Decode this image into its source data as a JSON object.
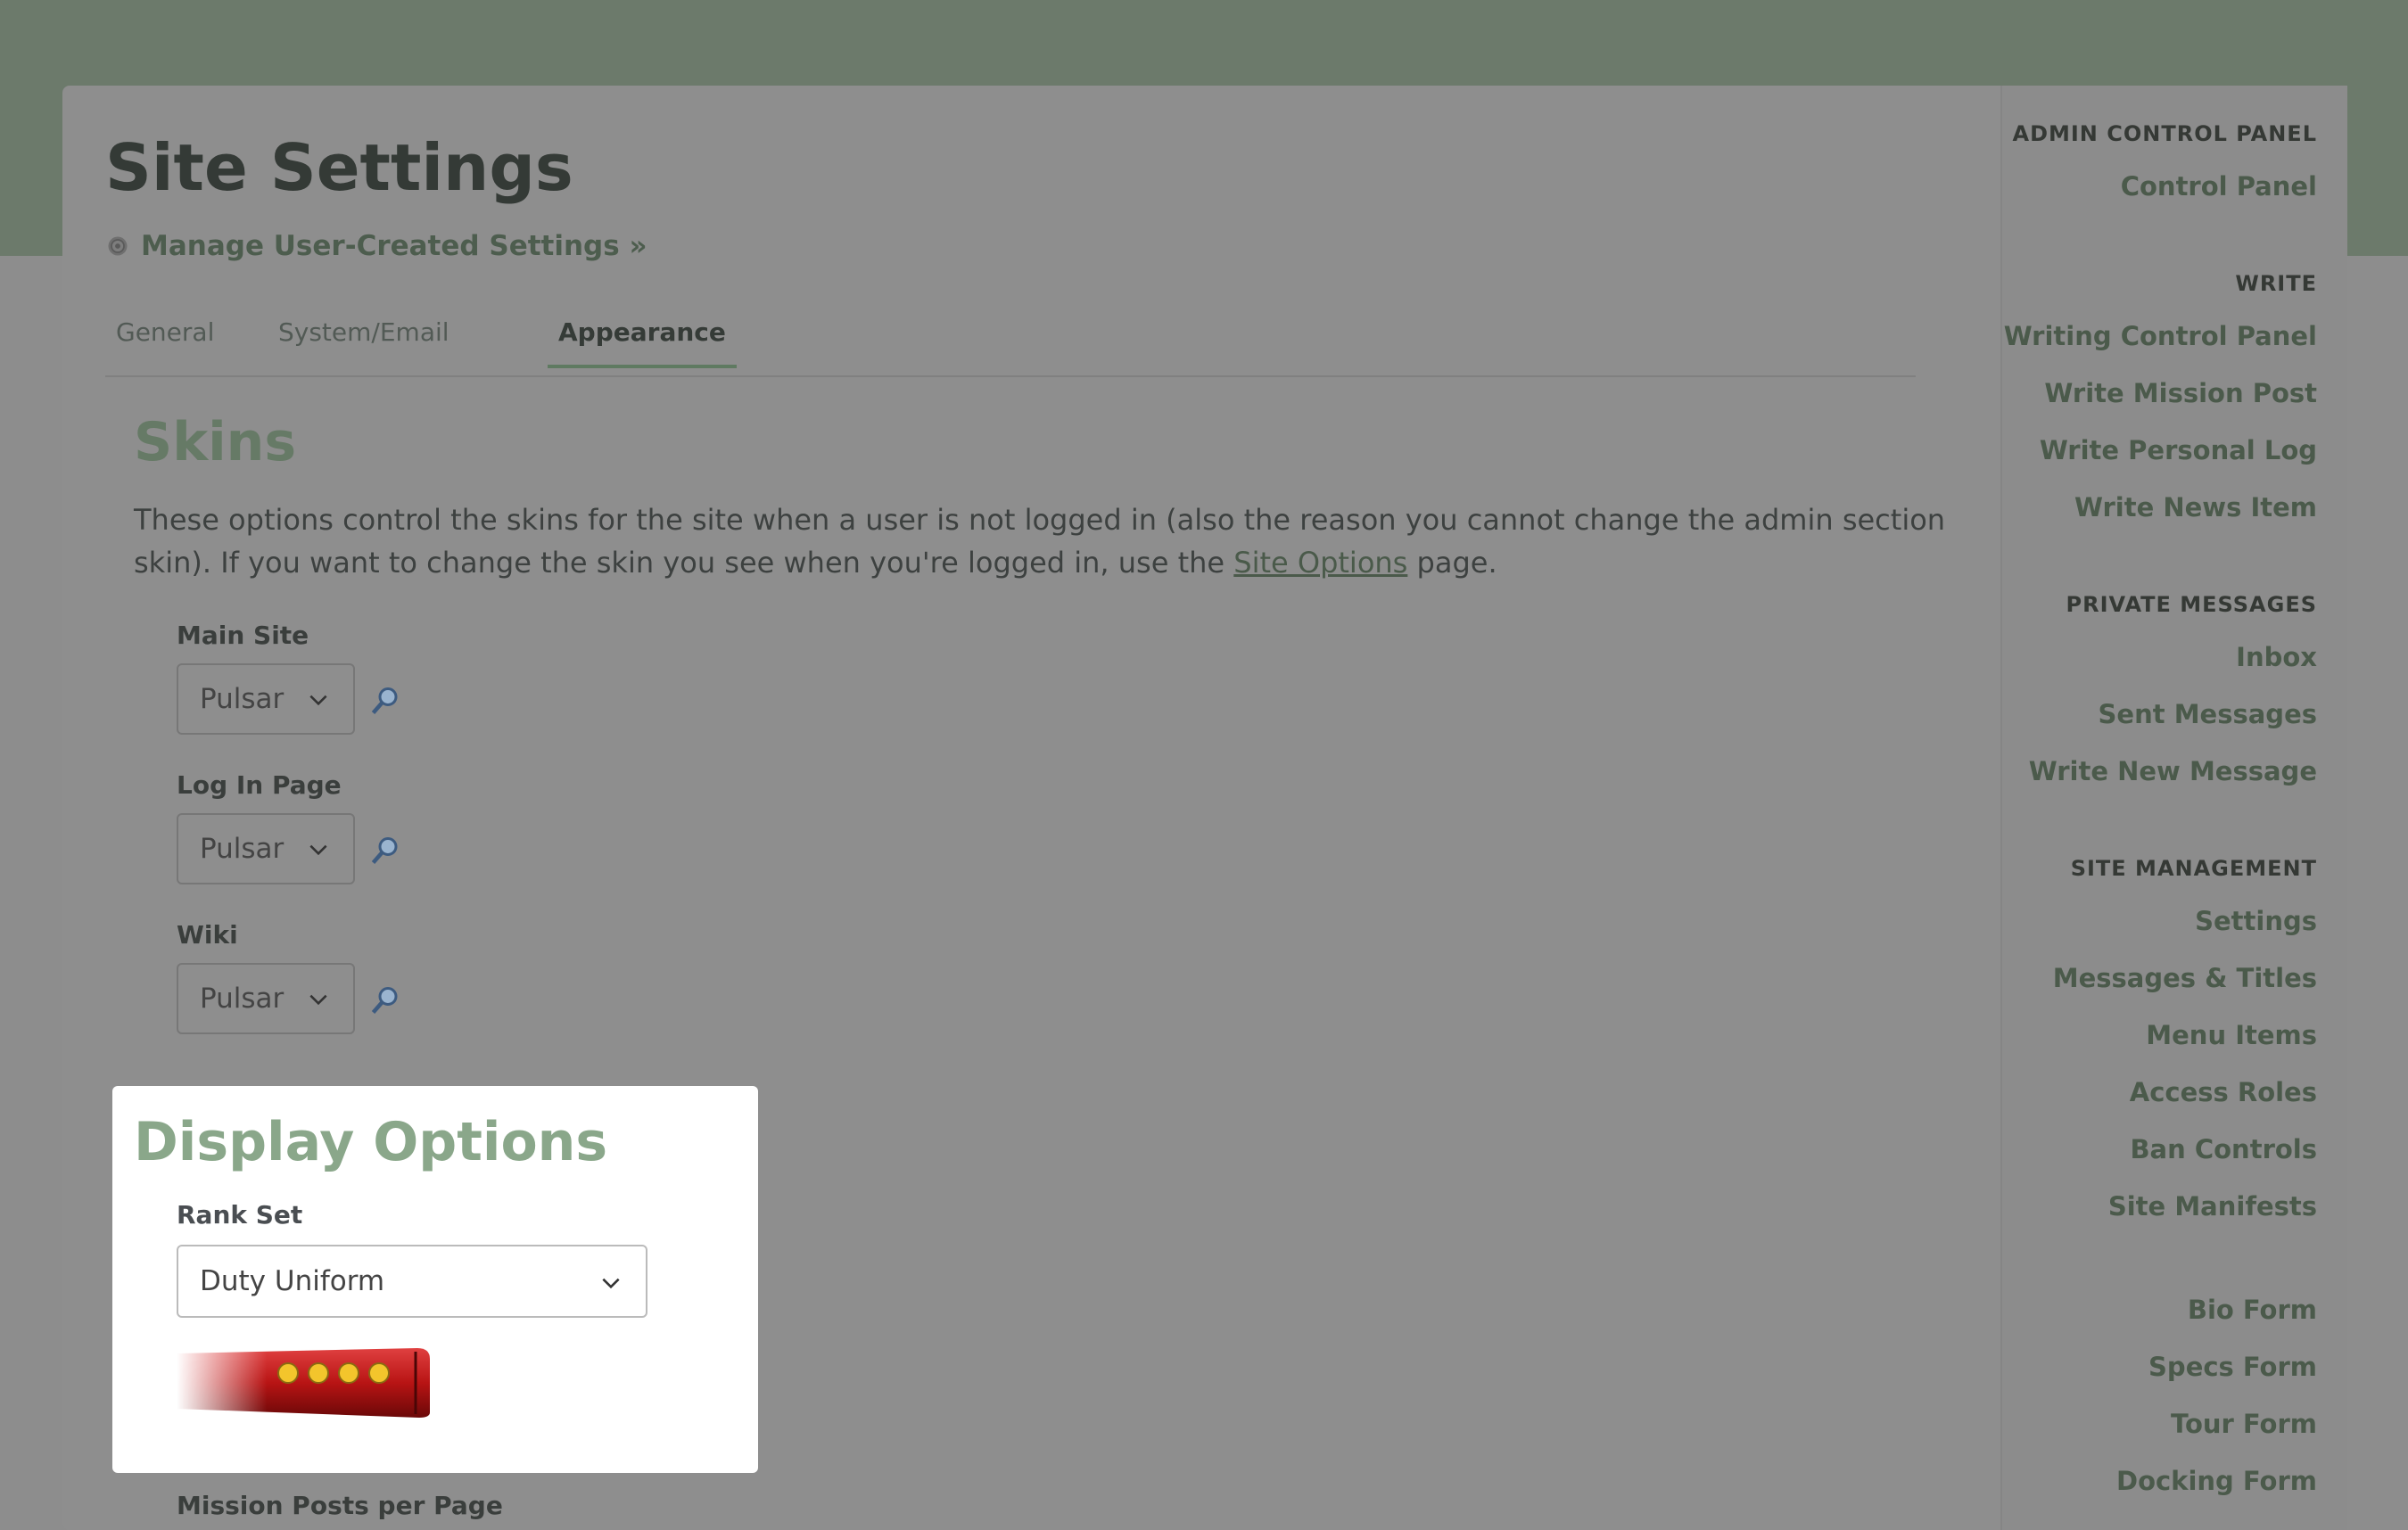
{
  "page": {
    "title": "Site Settings",
    "manage_link": "Manage User-Created Settings »"
  },
  "tabs": [
    {
      "label": "General",
      "active": false
    },
    {
      "label": "System/Email",
      "active": false
    },
    {
      "label": "Appearance",
      "active": true
    }
  ],
  "skins": {
    "heading": "Skins",
    "description_before": "These options control the skins for the site when a user is not logged in (also the reason you cannot change the admin section skin). If you want to change the skin you see when you're logged in, use the ",
    "description_link": "Site Options",
    "description_after": " page.",
    "fields": [
      {
        "label": "Main Site",
        "value": "Pulsar"
      },
      {
        "label": "Log In Page",
        "value": "Pulsar"
      },
      {
        "label": "Wiki",
        "value": "Pulsar"
      }
    ]
  },
  "display_options": {
    "heading": "Display Options",
    "rank_set_label": "Rank Set",
    "rank_set_value": "Duty Uniform",
    "rank_pips": 4,
    "next_label": "Mission Posts per Page"
  },
  "sidebar": {
    "sections": [
      {
        "heading": "ADMIN CONTROL PANEL",
        "items": [
          "Control Panel"
        ]
      },
      {
        "heading": "WRITE",
        "items": [
          "Writing Control Panel",
          "Write Mission Post",
          "Write Personal Log",
          "Write News Item"
        ]
      },
      {
        "heading": "PRIVATE MESSAGES",
        "items": [
          "Inbox",
          "Sent Messages",
          "Write New Message"
        ]
      },
      {
        "heading": "SITE MANAGEMENT",
        "items": [
          "Settings",
          "Messages & Titles",
          "Menu Items",
          "Access Roles",
          "Ban Controls",
          "Site Manifests"
        ]
      },
      {
        "heading": "",
        "items": [
          "Bio Form",
          "Specs Form",
          "Tour Form",
          "Docking Form"
        ]
      }
    ]
  },
  "icons": {
    "gear": "gear-icon",
    "preview": "magnifier-icon",
    "dropdown": "chevron-down-icon"
  },
  "colors": {
    "accent": "#8aa78a",
    "header_band": "#6c7a6b",
    "overlay_bg": "#8e8e8e",
    "rank_red": "#c01818",
    "rank_pip": "#f3c52c"
  }
}
